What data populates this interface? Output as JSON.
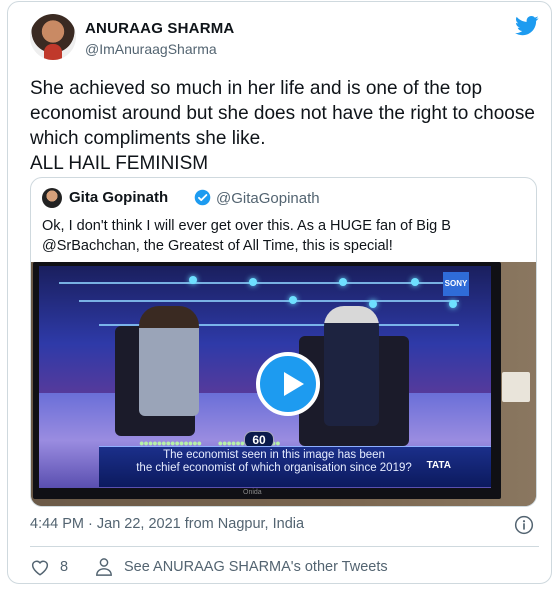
{
  "tweet": {
    "author_name": "ANURAAG SHARMA",
    "author_handle": "@ImAnuraagSharma",
    "text_lines": [
      "She achieved so much in her life and is one of the top",
      "economist around but she does not have the right to choose",
      "which compliments she like.",
      "ALL HAIL FEMINISM"
    ],
    "timestamp": "4:44 PM · Jan 22, 2021 from Nagpur, India",
    "like_count": "8",
    "see_more_label": "See ANURAAG SHARMA's other Tweets"
  },
  "quoted": {
    "author_name": "Gita Gopinath",
    "author_handle": "@GitaGopinath",
    "text_lines": [
      "Ok, I don't think I will ever get over this. As a HUGE fan of Big B",
      "@SrBachchan, the Greatest of All Time, this is special!"
    ],
    "video": {
      "badge_number": "60",
      "question_line1": "The economist seen in this image has been",
      "question_line2": "the chief economist of which organisation since 2019?",
      "sponsor": "TATA",
      "channel": "SONY",
      "tv_brand": "Onida"
    }
  },
  "icons": {
    "bird": "twitter-bird-icon",
    "verified": "verified-badge-icon",
    "info": "info-icon",
    "like": "heart-icon",
    "profile": "person-icon",
    "play": "play-icon"
  },
  "colors": {
    "accent": "#1d9bf0",
    "muted": "#536471",
    "border": "#cfd9de"
  }
}
